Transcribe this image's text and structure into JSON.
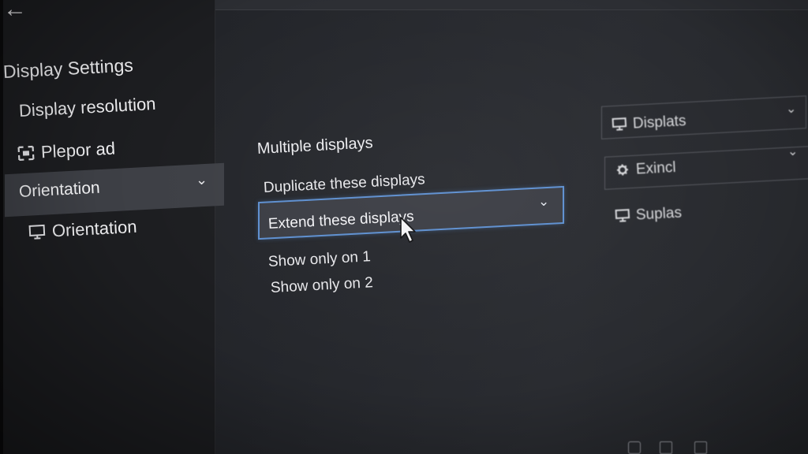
{
  "nav": {
    "back_glyph": "←"
  },
  "sidebar": {
    "title": "Display Settings",
    "items": [
      {
        "label": "Display resolution",
        "icon": "none"
      },
      {
        "label": "Plepor ad",
        "icon": "scale-icon"
      },
      {
        "label": "Orientation",
        "icon": "none",
        "selected": true
      },
      {
        "label": "Orientation",
        "icon": "monitor-icon"
      }
    ],
    "chevron_glyph": "⌄"
  },
  "main": {
    "heading": "Multiple displays",
    "options": [
      {
        "label": "Duplicate these displays"
      },
      {
        "label": "Extend these displays",
        "selected": true
      },
      {
        "label": "Show only on 1"
      },
      {
        "label": "Show only on 2"
      }
    ],
    "chevron_glyph": "⌄"
  },
  "right_panel": {
    "items": [
      {
        "label": "Displats",
        "icon": "monitor-icon",
        "has_dropdown": true
      },
      {
        "label": "Exincl",
        "icon": "gear-icon",
        "has_dropdown": true
      },
      {
        "label": "Suplas",
        "icon": "monitor-icon",
        "has_dropdown": false
      }
    ],
    "chevron_glyph": "⌄"
  },
  "colors": {
    "accent": "#5d8fd0",
    "background": "#24262b",
    "sidebar_bg": "#1c1d20",
    "selected_bg": "#3d3f45"
  }
}
